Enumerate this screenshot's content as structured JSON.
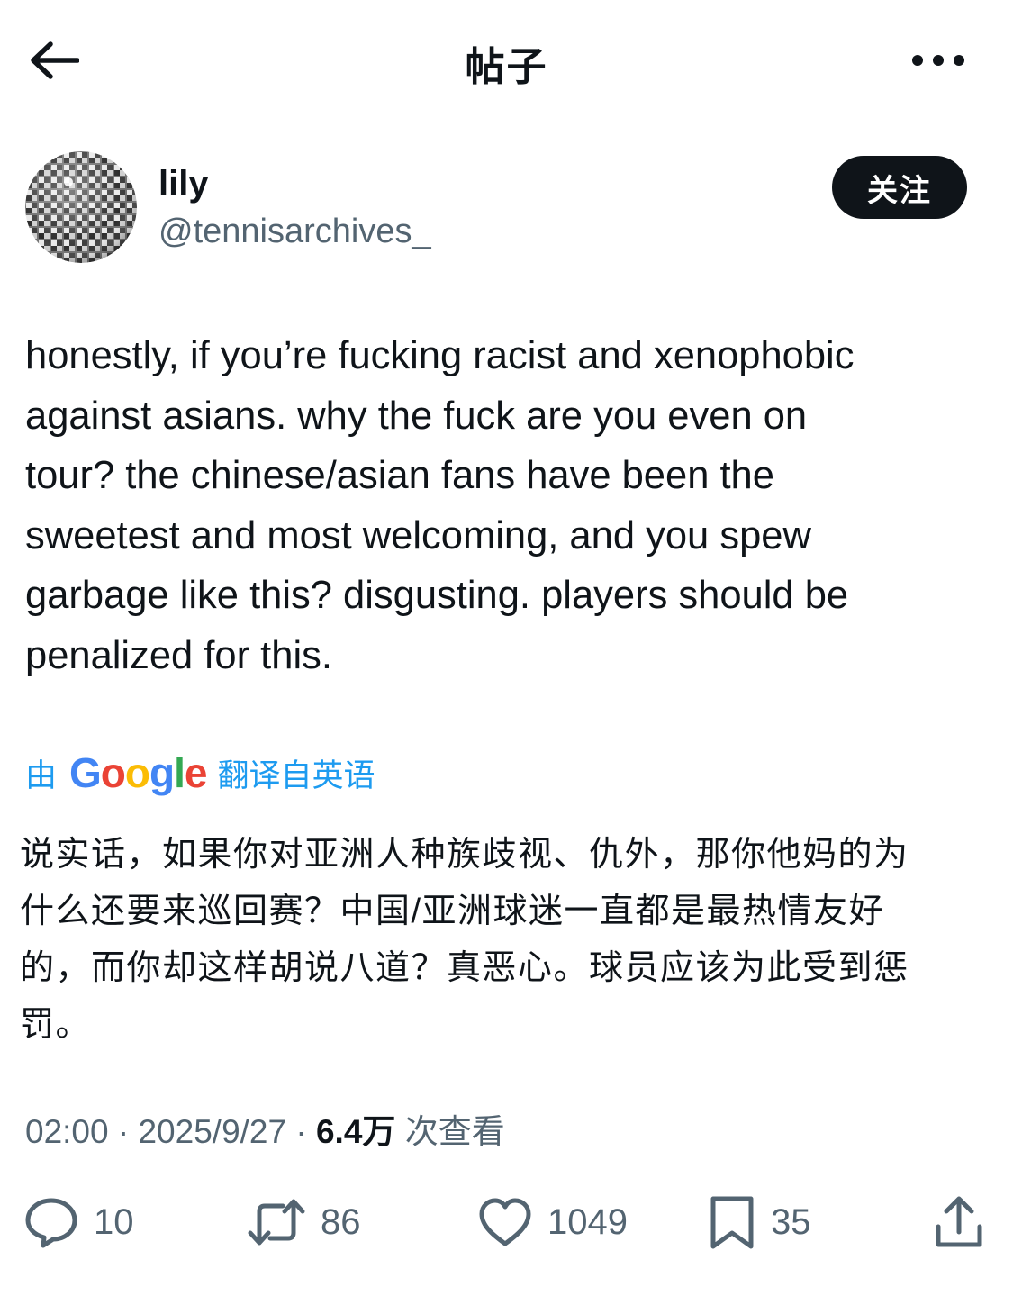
{
  "header": {
    "title": "帖子",
    "back_icon": "arrow-left-icon",
    "more_icon": "more-horizontal-icon"
  },
  "author": {
    "display_name": "lily",
    "handle": "@tennisarchives_",
    "avatar_icon": "disco-ball-avatar",
    "follow_label": "关注"
  },
  "post": {
    "text": "honestly, if you’re fucking racist and xenophobic\nagainst asians. why the fuck are you even on\ntour? the chinese/asian fans have been the\nsweetest and most welcoming, and you spew\ngarbage like this? disgusting. players should be\npenalized for this."
  },
  "translation": {
    "by": "由",
    "provider": "Google",
    "label": "翻译自英语",
    "text": "说实话，如果你对亚洲人种族歧视、仇外，那你他妈的为\n什么还要来巡回赛？中国/亚洲球迷一直都是最热情友好\n的，而你却这样胡说八道？真恶心。球员应该为此受到惩\n罚。"
  },
  "meta": {
    "time": "02:00",
    "sep": " · ",
    "date": "2025/9/27",
    "views_count": "6.4万",
    "views_label": " 次查看"
  },
  "actions": {
    "reply": {
      "icon": "reply-icon",
      "count": "10"
    },
    "repost": {
      "icon": "repost-icon",
      "count": "86"
    },
    "like": {
      "icon": "heart-icon",
      "count": "1049"
    },
    "bookmark": {
      "icon": "bookmark-icon",
      "count": "35"
    },
    "share": {
      "icon": "share-icon"
    }
  },
  "colors": {
    "text": "#0f1419",
    "secondary": "#536471",
    "link": "#1d9bf0",
    "button_bg": "#0f1419"
  }
}
